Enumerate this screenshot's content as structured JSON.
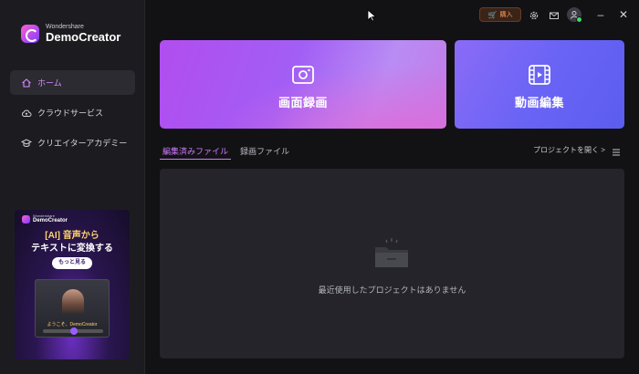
{
  "app": {
    "brand": "Wondershare",
    "product": "DemoCreator"
  },
  "sidebar": {
    "items": [
      {
        "label": "ホーム",
        "icon": "home-icon",
        "active": true
      },
      {
        "label": "クラウドサービス",
        "icon": "cloud-icon",
        "active": false
      },
      {
        "label": "クリエイターアカデミー",
        "icon": "academy-icon",
        "active": false
      }
    ],
    "promo": {
      "brand": "Wondershare",
      "product": "DemoCreator",
      "title_line1": "[AI] 音声から",
      "title_line2": "テキストに変換する",
      "button": "もっと見る",
      "caption": "ようこそ、DemoCreator"
    }
  },
  "topbar": {
    "buy_label": "購入",
    "icons": [
      "settings-icon",
      "mail-icon",
      "account-icon"
    ],
    "window_buttons": [
      "minimize-icon",
      "close-icon"
    ]
  },
  "cards": {
    "record_label": "画面録画",
    "edit_label": "動画編集"
  },
  "tabs": {
    "edited": "編集済みファイル",
    "recorded": "録画ファイル"
  },
  "open_project": "プロジェクトを開く >",
  "empty_state": "最近使用したプロジェクトはありません",
  "colors": {
    "accent": "#cf7bff",
    "record_card": "#b24df0",
    "edit_card": "#6a64f5",
    "buy": "#ff9a5a"
  }
}
